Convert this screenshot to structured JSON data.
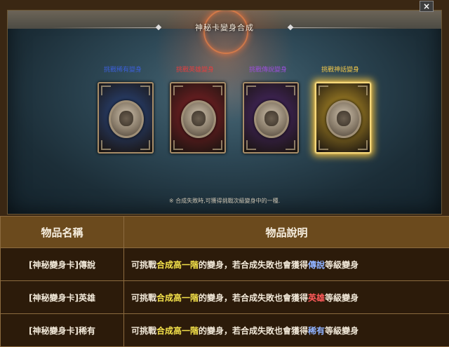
{
  "dialog": {
    "title": "神秘卡變身合成",
    "close_label": "×",
    "note": "※ 合成失敗時,可獲得挑戰次級變身中的一種.",
    "cards": [
      {
        "label": "挑戰稀有變身",
        "label_color": "#3c5fd8",
        "card_color": "#2c4d8c",
        "selected": false
      },
      {
        "label": "挑戰英雄變身",
        "label_color": "#e04040",
        "card_color": "#8c2228",
        "selected": false
      },
      {
        "label": "挑戰傳說變身",
        "label_color": "#9b4fd9",
        "card_color": "#4e2a72",
        "selected": false
      },
      {
        "label": "挑戰神話變身",
        "label_color": "#f0c64a",
        "card_color": "#c8a02a",
        "selected": true
      }
    ]
  },
  "table": {
    "headers": [
      "物品名稱",
      "物品說明"
    ],
    "rows": [
      {
        "name": "[神秘變身卡]傳說",
        "desc_a": "可挑戰",
        "desc_hl": "合成高一階",
        "desc_b": "的變身，若合成失敗也會獲得",
        "grade": "傳說",
        "grade_color": "#8fb2ff",
        "desc_c": "等級變身"
      },
      {
        "name": "[神秘變身卡]英雄",
        "desc_a": "可挑戰",
        "desc_hl": "合成高一階",
        "desc_b": "的變身，若合成失敗也會獲得",
        "grade": "英雄",
        "grade_color": "#ff5a5a",
        "desc_c": "等級變身"
      },
      {
        "name": "[神秘變身卡]稀有",
        "desc_a": "可挑戰",
        "desc_hl": "合成高一階",
        "desc_b": "的變身，若合成失敗也會獲得",
        "grade": "稀有",
        "grade_color": "#8fb2ff",
        "desc_c": "等級變身"
      }
    ]
  }
}
